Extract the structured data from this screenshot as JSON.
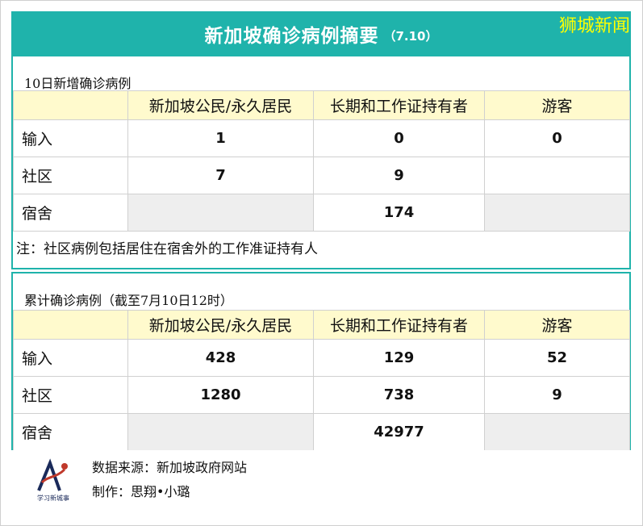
{
  "header": {
    "title": "新加坡确诊病例摘要",
    "date": "（7.10）",
    "brand": "狮城新闻"
  },
  "new_cases": {
    "caption": "10日新增确诊病例",
    "columns": [
      "新加坡公民/永久居民",
      "长期和工作证持有者",
      "游客"
    ],
    "rows": [
      {
        "label": "输入",
        "values": [
          "1",
          "0",
          "0"
        ]
      },
      {
        "label": "社区",
        "values": [
          "7",
          "9",
          ""
        ]
      },
      {
        "label": "宿舍",
        "values": [
          "",
          "174",
          ""
        ]
      }
    ],
    "note": "注：社区病例包括居住在宿舍外的工作准证持有人"
  },
  "cumulative": {
    "caption": "累计确诊病例（截至7月10日12时）",
    "columns": [
      "新加坡公民/永久居民",
      "长期和工作证持有者",
      "游客"
    ],
    "rows": [
      {
        "label": "输入",
        "values": [
          "428",
          "129",
          "52"
        ]
      },
      {
        "label": "社区",
        "values": [
          "1280",
          "738",
          "9"
        ]
      },
      {
        "label": "宿舍",
        "values": [
          "",
          "42977",
          ""
        ]
      }
    ]
  },
  "footer": {
    "source": "数据来源：新加坡政府网站",
    "maker": "制作：思翔•小璐",
    "logo_text": "学习新城事"
  },
  "colors": {
    "accent": "#1fb3ab",
    "header_row": "#fffacd",
    "gray_cell": "#eeeeee",
    "brand": "#ffff00"
  }
}
